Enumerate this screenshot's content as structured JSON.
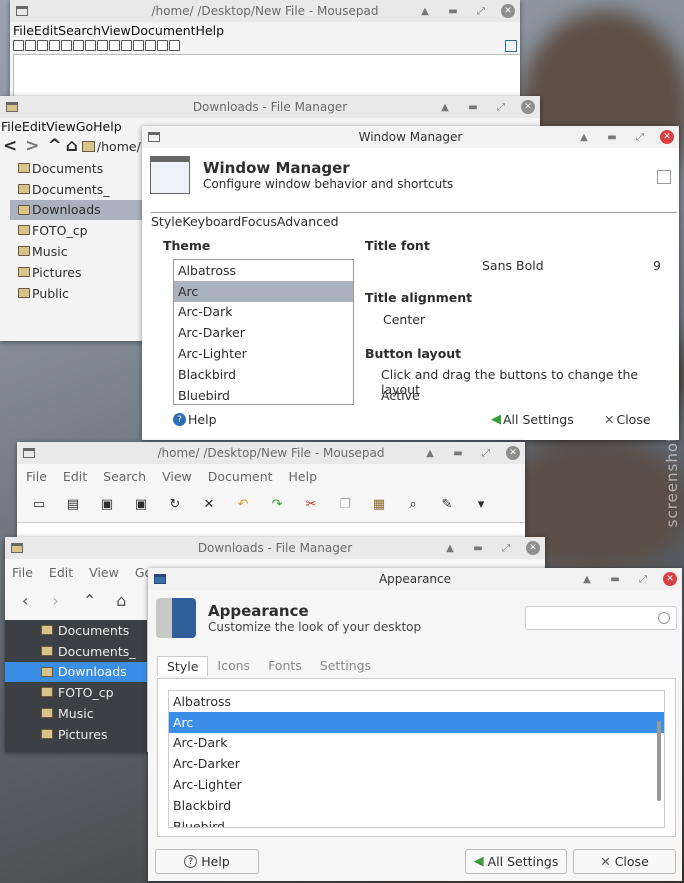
{
  "top": {
    "mousepad": {
      "title": "/home/      /Desktop/New File - Mousepad",
      "menu": [
        "File",
        "Edit",
        "Search",
        "View",
        "Document",
        "Help"
      ]
    },
    "filemanager": {
      "title": "Downloads - File Manager",
      "menu": [
        "File",
        "Edit",
        "View",
        "Go",
        "Help"
      ],
      "path": "/home/",
      "items": [
        "Documents",
        "Documents_",
        "Downloads",
        "FOTO_cp",
        "Music",
        "Pictures",
        "Public"
      ],
      "selected": "Downloads"
    },
    "wm": {
      "window_title": "Window Manager",
      "heading": "Window Manager",
      "subheading": "Configure window behavior and shortcuts",
      "tabs": [
        "Style",
        "Keyboard",
        "Focus",
        "Advanced"
      ],
      "theme_label": "Theme",
      "themes": [
        "Albatross",
        "Arc",
        "Arc-Dark",
        "Arc-Darker",
        "Arc-Lighter",
        "Blackbird",
        "Bluebird"
      ],
      "selected_theme": "Arc",
      "title_font_label": "Title font",
      "title_font": "Sans Bold",
      "title_font_size": "9",
      "title_alignment_label": "Title alignment",
      "title_alignment": "Center",
      "button_layout_label": "Button layout",
      "button_layout_hint": "Click and drag the buttons to change the layout",
      "button_layout_active": "Active",
      "help": "Help",
      "all_settings": "All Settings",
      "close": "Close"
    }
  },
  "bottom": {
    "mousepad": {
      "title": "/home/      /Desktop/New File - Mousepad",
      "menu": [
        "File",
        "Edit",
        "Search",
        "View",
        "Document",
        "Help"
      ]
    },
    "filemanager": {
      "title": "Downloads - File Manager",
      "menu": [
        "File",
        "Edit",
        "View",
        "Go"
      ],
      "items": [
        "Documents",
        "Documents_",
        "Downloads",
        "FOTO_cp",
        "Music",
        "Pictures"
      ],
      "selected": "Downloads"
    },
    "appearance": {
      "window_title": "Appearance",
      "heading": "Appearance",
      "subheading": "Customize the look of your desktop",
      "tabs": [
        "Style",
        "Icons",
        "Fonts",
        "Settings"
      ],
      "themes": [
        "Albatross",
        "Arc",
        "Arc-Dark",
        "Arc-Darker",
        "Arc-Lighter",
        "Blackbird",
        "Bluebird"
      ],
      "selected_theme": "Arc",
      "help": "Help",
      "all_settings": "All Settings",
      "close": "Close"
    }
  },
  "watermark": "screenshots.debian.net",
  "colors": {
    "selection_light": "#aab2c0",
    "selection_blue": "#3a8ee6",
    "close_red": "#d94040"
  }
}
